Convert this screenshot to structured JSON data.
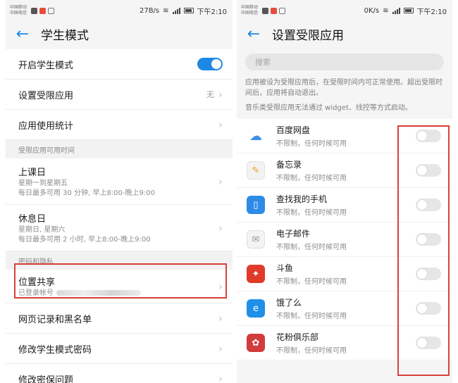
{
  "left": {
    "status": {
      "carrier1": "中国移动",
      "carrier2": "中国电信",
      "speed": "27B/s",
      "time": "下午2:10"
    },
    "title": "学生模式",
    "items": [
      {
        "label": "开启学生模式"
      },
      {
        "label": "设置受限应用",
        "value": "无"
      },
      {
        "label": "应用使用统计"
      }
    ],
    "section1": "受限应用可用时间",
    "schedule": [
      {
        "label": "上课日",
        "sub1": "星期一到星期五",
        "sub2": "每日最多可用 30 分钟, 早上8:00-晚上9:00"
      },
      {
        "label": "休息日",
        "sub1": "星期日, 星期六",
        "sub2": "每日最多可用 2 小时, 早上8:00-晚上9:00"
      }
    ],
    "section2": "密码和隐私",
    "location": {
      "label": "位置共享",
      "sub": "已登录帐号"
    },
    "more": [
      {
        "label": "网页记录和黑名单"
      },
      {
        "label": "修改学生模式密码"
      },
      {
        "label": "修改密保问题"
      }
    ]
  },
  "right": {
    "status": {
      "carrier1": "中国移动",
      "carrier2": "中国电信",
      "speed": "0K/s",
      "time": "下午2:10"
    },
    "title": "设置受限应用",
    "search_placeholder": "搜索",
    "desc": "应用被设为受限应用后，在受限时间内可正常使用。超出受限时间后，应用将自动退出。",
    "desc2": "音乐类受限应用无法通过 widget、线控等方式启动。",
    "apps": [
      {
        "name": "百度网盘",
        "sub": "不限制，任何时候可用",
        "color": "#3f8ee8"
      },
      {
        "name": "备忘录",
        "sub": "不限制，任何时候可用",
        "color": "#f0a020"
      },
      {
        "name": "查找我的手机",
        "sub": "不限制，任何时候可用",
        "color": "#2d8be6"
      },
      {
        "name": "电子邮件",
        "sub": "不限制，任何时候可用",
        "color": "#b0b0b0"
      },
      {
        "name": "斗鱼",
        "sub": "不限制，任何时候可用",
        "color": "#e03a2a"
      },
      {
        "name": "饿了么",
        "sub": "不限制，任何时候可用",
        "color": "#1e90e8"
      },
      {
        "name": "花粉俱乐部",
        "sub": "不限制，任何时候可用",
        "color": "#d23c3c"
      }
    ]
  },
  "colors": {
    "accent": "#1e88e5",
    "highlight": "#d6413a"
  }
}
